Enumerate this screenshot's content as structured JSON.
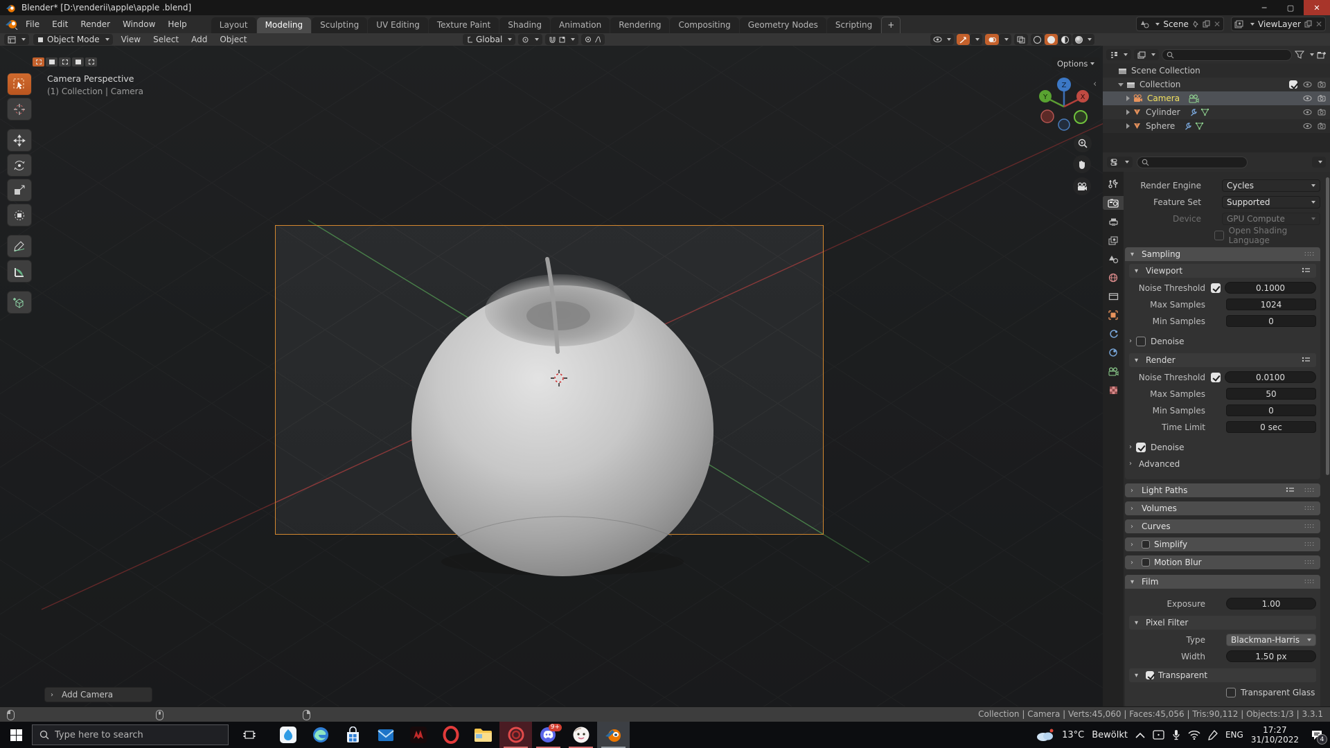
{
  "title_bar": {
    "title": "Blender* [D:\\renderii\\apple\\apple .blend]"
  },
  "top_bar": {
    "menus": [
      "File",
      "Edit",
      "Render",
      "Window",
      "Help"
    ],
    "tabs": [
      "Layout",
      "Modeling",
      "Sculpting",
      "UV Editing",
      "Texture Paint",
      "Shading",
      "Animation",
      "Rendering",
      "Compositing",
      "Geometry Nodes",
      "Scripting"
    ],
    "active_tab": "Modeling",
    "new_tab_label": "+",
    "scene_value": "Scene",
    "view_layer_value": "ViewLayer"
  },
  "viewport_header": {
    "mode": "Object Mode",
    "menus": [
      "View",
      "Select",
      "Add",
      "Object"
    ],
    "orientation": "Global"
  },
  "viewport": {
    "view_label": "Camera Perspective",
    "context_label": "(1) Collection | Camera",
    "options_label": "Options",
    "operator_label": "Add Camera",
    "axis_x": "X",
    "axis_y": "Y",
    "axis_z": "Z"
  },
  "outliner": {
    "rows": [
      {
        "label": "Scene Collection"
      },
      {
        "label": "Collection"
      },
      {
        "label": "Camera"
      },
      {
        "label": "Cylinder"
      },
      {
        "label": "Sphere"
      }
    ]
  },
  "properties": {
    "render_engine_label": "Render Engine",
    "render_engine_value": "Cycles",
    "feature_set_label": "Feature Set",
    "feature_set_value": "Supported",
    "device_label": "Device",
    "device_value": "GPU Compute",
    "osl_label": "Open Shading Language",
    "sampling_title": "Sampling",
    "viewport_title": "Viewport",
    "vp_noise_label": "Noise Threshold",
    "vp_noise_value": "0.1000",
    "vp_max_label": "Max Samples",
    "vp_max_value": "1024",
    "vp_min_label": "Min Samples",
    "vp_min_value": "0",
    "vp_denoise_label": "Denoise",
    "render_title": "Render",
    "r_noise_label": "Noise Threshold",
    "r_noise_value": "0.0100",
    "r_max_label": "Max Samples",
    "r_max_value": "50",
    "r_min_label": "Min Samples",
    "r_min_value": "0",
    "r_time_label": "Time Limit",
    "r_time_value": "0 sec",
    "r_denoise_label": "Denoise",
    "advanced_label": "Advanced",
    "light_paths_title": "Light Paths",
    "volumes_title": "Volumes",
    "curves_title": "Curves",
    "simplify_title": "Simplify",
    "motion_blur_title": "Motion Blur",
    "film_title": "Film",
    "exposure_label": "Exposure",
    "exposure_value": "1.00",
    "pixel_filter_title": "Pixel Filter",
    "pf_type_label": "Type",
    "pf_type_value": "Blackman-Harris",
    "pf_width_label": "Width",
    "pf_width_value": "1.50 px",
    "transparent_label": "Transparent",
    "transparent_glass_label": "Transparent Glass"
  },
  "status_bar": {
    "info": "Collection | Camera | Verts:45,060 | Faces:45,056 | Tris:90,112 | Objects:1/3 | 3.3.1"
  },
  "taskbar": {
    "search_placeholder": "Type here to search",
    "weather_temp": "13°C",
    "weather_desc": "Bewölkt",
    "language": "ENG",
    "time": "17:27",
    "date": "31/10/2022",
    "notification_count": "4",
    "discord_badge": "9+"
  }
}
